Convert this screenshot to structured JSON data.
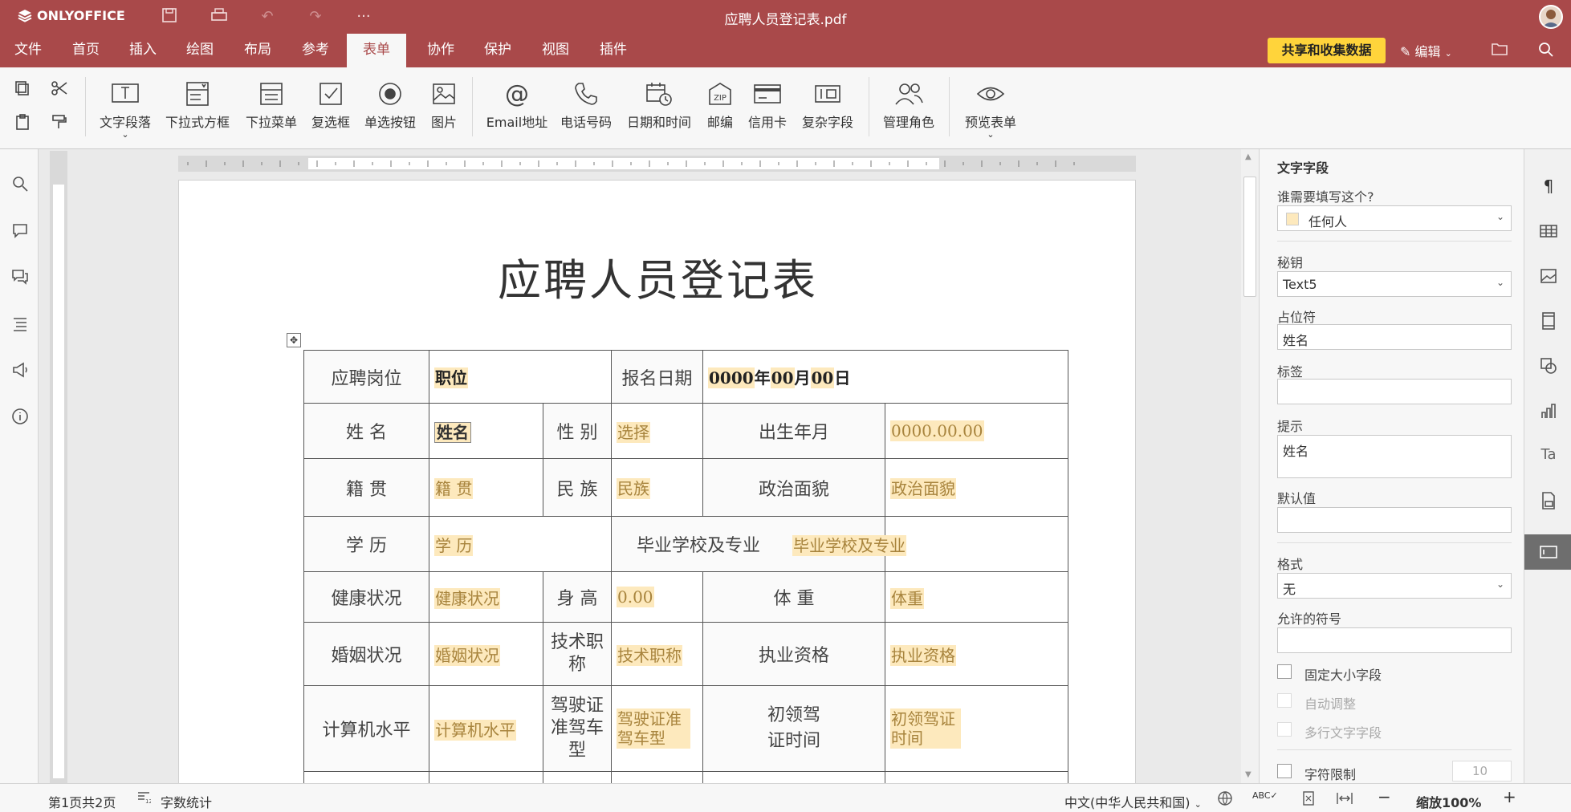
{
  "app": {
    "name": "ONLYOFFICE",
    "doc_title": "应聘人员登记表.pdf"
  },
  "menu": {
    "tabs": [
      "文件",
      "首页",
      "插入",
      "绘图",
      "布局",
      "参考",
      "表单",
      "协作",
      "保护",
      "视图",
      "插件"
    ],
    "active": "表单",
    "share_label": "共享和收集数据",
    "edit_label": "编辑"
  },
  "toolbar": {
    "tools": [
      "文字段落",
      "下拉式方框",
      "下拉菜单",
      "复选框",
      "单选按钮",
      "图片",
      "Email地址",
      "电话号码",
      "日期和时间",
      "邮编",
      "信用卡",
      "复杂字段",
      "管理角色",
      "预览表单"
    ]
  },
  "document": {
    "heading": "应聘人员登记表",
    "rows": [
      {
        "labels": [
          "应聘岗位",
          "报名日期"
        ]
      },
      {
        "labels": [
          "姓 名",
          "性 别",
          "出生年月"
        ]
      },
      {
        "labels": [
          "籍 贯",
          "民 族",
          "政治面貌"
        ]
      },
      {
        "labels": [
          "学 历",
          "毕业学校及专业"
        ]
      },
      {
        "labels": [
          "健康状况",
          "身 高",
          "体 重"
        ]
      },
      {
        "labels": [
          "婚姻状况",
          "技术职称",
          "执业资格"
        ]
      },
      {
        "labels": [
          "计算机水平",
          "驾驶证准驾车型",
          "初领驾证时间"
        ]
      }
    ],
    "fields": {
      "position": "职位",
      "date_y": "0000",
      "date_y_u": "年",
      "date_m": "00",
      "date_m_u": "月",
      "date_d": "00",
      "date_d_u": "日",
      "name": "姓名",
      "gender": "选择",
      "birth": "0000.00.00",
      "origin": "籍 贯",
      "ethnic": "民族",
      "political": "政治面貌",
      "edu": "学 历",
      "school": "毕业学校及专业",
      "health": "健康状况",
      "height": "0.00",
      "weight": "体重",
      "marital": "婚姻状况",
      "title": "技术职称",
      "qual": "执业资格",
      "computer": "计算机水平",
      "license": "驾驶证准驾车型",
      "license_date": "初领驾证时间"
    }
  },
  "panel": {
    "title": "文字字段",
    "who_label": "谁需要填写这个?",
    "who_value": "任何人",
    "key_label": "秘钥",
    "key_value": "Text5",
    "placeholder_label": "占位符",
    "placeholder_value": "姓名",
    "tag_label": "标签",
    "tag_value": "",
    "tip_label": "提示",
    "tip_value": "姓名",
    "default_label": "默认值",
    "default_value": "",
    "format_label": "格式",
    "format_value": "无",
    "allowed_label": "允许的符号",
    "allowed_value": "",
    "fixed_size": "固定大小字段",
    "autofit": "自动调整",
    "multiline": "多行文字字段",
    "char_limit": "字符限制",
    "char_limit_value": "10"
  },
  "status": {
    "page": "第1页共2页",
    "word_count": "字数统计",
    "language": "中文(中华人民共和国)",
    "zoom": "缩放100%"
  },
  "colors": {
    "brand": "#a9494a",
    "share": "#ffd43b",
    "field_bg": "#fde9bd"
  }
}
